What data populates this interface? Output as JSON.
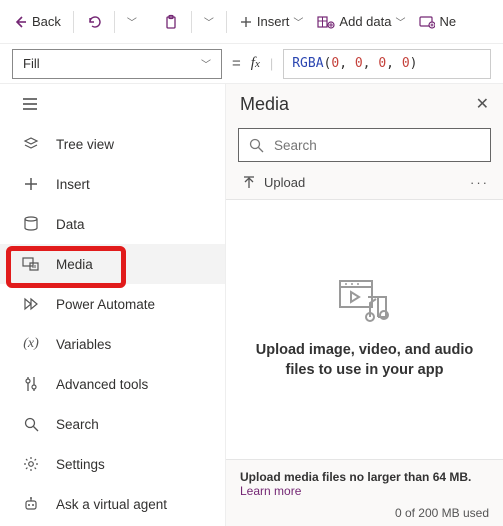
{
  "toolbar": {
    "back_label": "Back",
    "insert_label": "Insert",
    "add_data_label": "Add data",
    "new_label": "Ne"
  },
  "fx": {
    "property": "Fill",
    "fn": "RGBA",
    "args": [
      "0",
      "0",
      "0",
      "0"
    ]
  },
  "nav": {
    "items": [
      {
        "label": "Tree view"
      },
      {
        "label": "Insert"
      },
      {
        "label": "Data"
      },
      {
        "label": "Media"
      },
      {
        "label": "Power Automate"
      },
      {
        "label": "Variables"
      },
      {
        "label": "Advanced tools"
      },
      {
        "label": "Search"
      },
      {
        "label": "Settings"
      },
      {
        "label": "Ask a virtual agent"
      }
    ]
  },
  "panel": {
    "title": "Media",
    "search_placeholder": "Search",
    "upload_label": "Upload",
    "empty_message": "Upload image, video, and audio files to use in your app",
    "footer_line": "Upload media files no larger than 64 MB.",
    "learn_more": "Learn more",
    "usage": "0 of 200 MB used"
  }
}
